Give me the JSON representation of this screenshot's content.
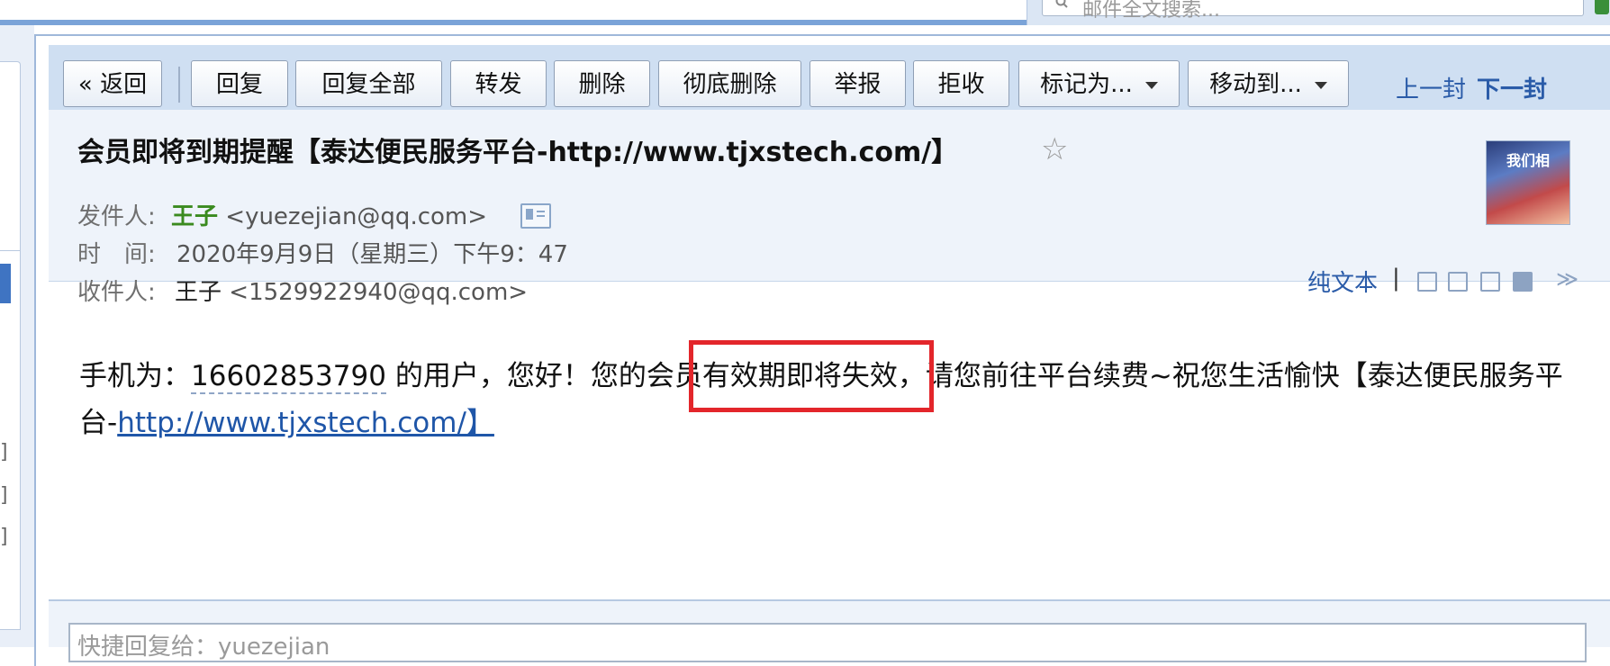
{
  "search": {
    "placeholder": "邮件全文搜索..."
  },
  "toolbar": {
    "back": "« 返回",
    "buttons": [
      "回复",
      "回复全部",
      "转发",
      "删除",
      "彻底删除",
      "举报",
      "拒收"
    ],
    "mark_as": "标记为...",
    "move_to": "移动到...",
    "prev": "上一封",
    "next": "下一封"
  },
  "mail": {
    "subject": "会员即将到期提醒【泰达便民服务平台-http://www.tjxstech.com/】",
    "from_label": "发件人:",
    "from_name": "王子",
    "from_email": "<yuezejian@qq.com>",
    "time_label": "时　间:",
    "time_value": "2020年9月9日（星期三）下午9：47",
    "to_label": "收件人:",
    "to_name": "王子",
    "to_email": "<1529922940@qq.com>",
    "plain_text": "纯文本",
    "pipe": "|",
    "avatar_text": "我们相"
  },
  "body": {
    "part1": "手机为：",
    "phone": "16602853790",
    "part2": " 的用户，您好！您的会员有效期即将失效，请您前往平台续费~祝您生活愉快【泰达便民服务平台-",
    "link": "http://www.tjxstech.com/】"
  },
  "quick_reply": {
    "placeholder": "快捷回复给：yuezejian"
  },
  "colors": {
    "accent": "#2a5ba8",
    "sender": "#3a8a1e",
    "highlight": "#e3262b",
    "header_bg": "#eef3fa",
    "toolbar_bg": "#cfdff2"
  },
  "icons": [
    "search-icon",
    "star-icon",
    "contact-card-icon",
    "new-window-icon",
    "note-icon",
    "download-icon",
    "print-icon",
    "expand-chevron-icon"
  ]
}
